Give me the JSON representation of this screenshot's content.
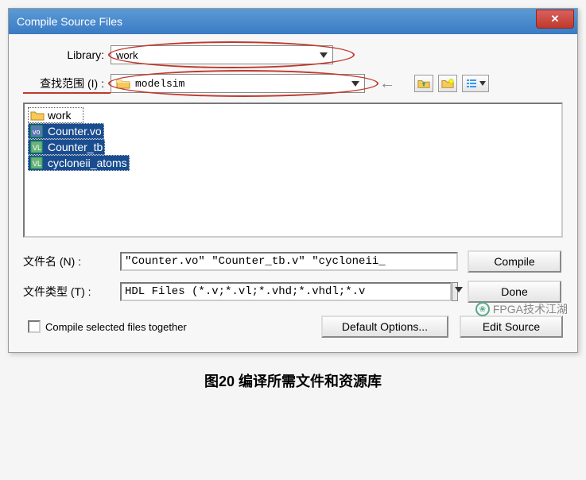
{
  "window": {
    "title": "Compile Source Files"
  },
  "library": {
    "label": "Library:",
    "value": "work"
  },
  "lookin": {
    "label": "查找范围 (I) :",
    "value": "modelsim"
  },
  "toolbar": {
    "back": "←",
    "up": "up-one-level",
    "new_folder": "new-folder",
    "view": "view-menu"
  },
  "file_list": [
    {
      "name": "work",
      "type": "folder",
      "selected": false
    },
    {
      "name": "Counter.vo",
      "type": "vo",
      "selected": true
    },
    {
      "name": "Counter_tb",
      "type": "vl",
      "selected": true
    },
    {
      "name": "cycloneii_atoms",
      "type": "vl",
      "selected": true
    }
  ],
  "filename": {
    "label": "文件名 (N) :",
    "value": "\"Counter.vo\" \"Counter_tb.v\" \"cycloneii_"
  },
  "filetype": {
    "label": "文件类型 (T) :",
    "value": "HDL Files (*.v;*.vl;*.vhd;*.vhdl;*.v"
  },
  "buttons": {
    "compile": "Compile",
    "done": "Done",
    "default_options": "Default Options...",
    "edit_source": "Edit Source"
  },
  "checkbox": {
    "label": "Compile selected files together"
  },
  "caption": "图20 编译所需文件和资源库",
  "watermark": "FPGA技术江湖"
}
